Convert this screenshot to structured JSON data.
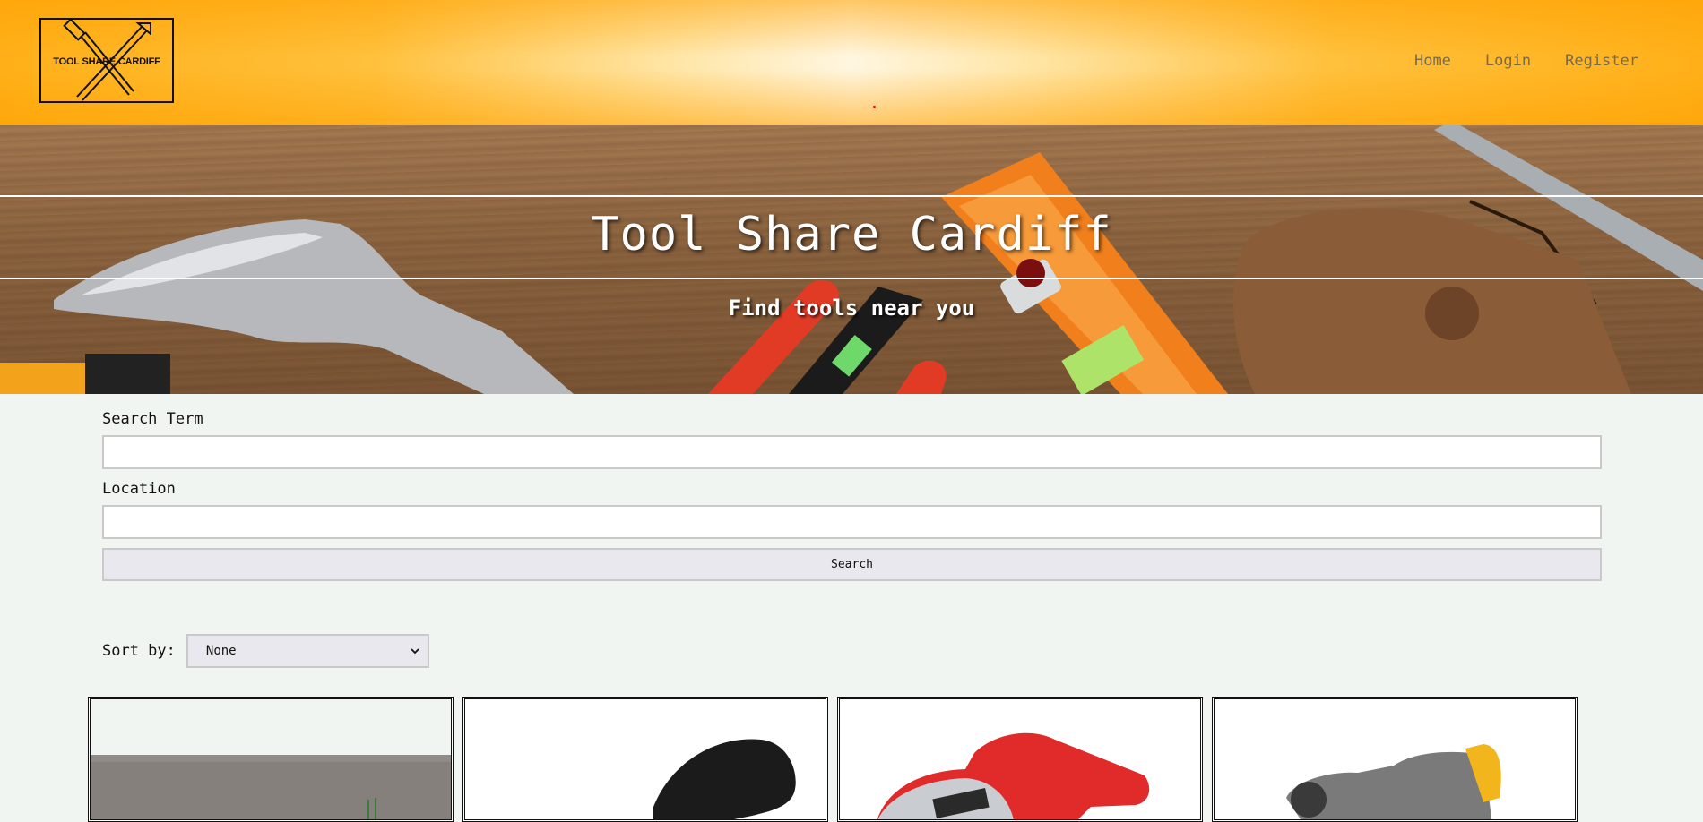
{
  "header": {
    "logo_text": "TOOL SHARE CARDIFF",
    "nav": {
      "home": "Home",
      "login": "Login",
      "register": "Register"
    }
  },
  "hero": {
    "title": "Tool Share Cardiff",
    "subtitle": "Find tools near you"
  },
  "search": {
    "term_label": "Search Term",
    "term_value": "",
    "location_label": "Location",
    "location_value": "",
    "button_label": "Search"
  },
  "sort": {
    "label": "Sort by:",
    "selected": "None"
  },
  "colors": {
    "header_orange": "#ffb018",
    "page_background": "#f1f5f1",
    "nav_text": "#7a6a48"
  },
  "icons": [
    "hammer-cross-logo-icon",
    "chevron-down-icon"
  ]
}
